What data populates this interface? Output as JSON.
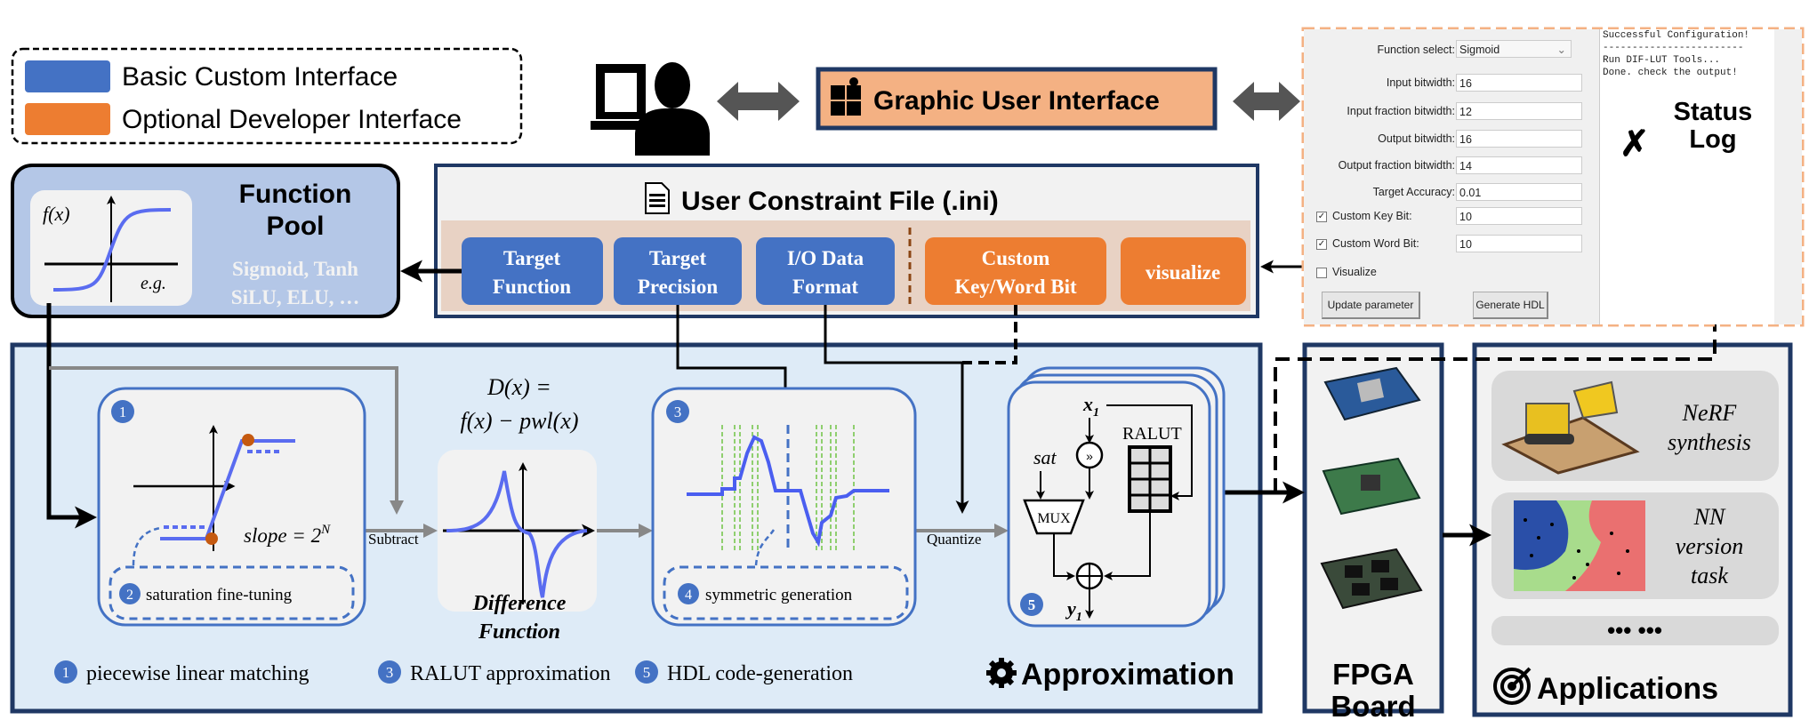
{
  "colors": {
    "basic": "#4472C4",
    "optional": "#ED7D31",
    "gui": "#F4B183",
    "frame": "#1F3864",
    "approx_bg": "#DEEBF7",
    "pool_bg": "#B4C7E7"
  },
  "legend": {
    "items": [
      {
        "label": "Basic Custom Interface",
        "color": "#4472C4"
      },
      {
        "label": "Optional Developer Interface",
        "color": "#ED7D31"
      }
    ]
  },
  "gui": {
    "title": "Graphic User Interface",
    "icon": "puzzle-icon"
  },
  "panel": {
    "function_select": {
      "label": "Function select:",
      "value": "Sigmoid"
    },
    "fields": [
      {
        "label": "Input bitwidth:",
        "value": "16"
      },
      {
        "label": "Input fraction bitwidth:",
        "value": "12"
      },
      {
        "label": "Output bitwidth:",
        "value": "16"
      },
      {
        "label": "Output fraction bitwidth:",
        "value": "14"
      },
      {
        "label": "Target Accuracy:",
        "value": "0.01"
      }
    ],
    "checks": [
      {
        "label": "Custom Key Bit:",
        "checked": true,
        "value": "10"
      },
      {
        "label": "Custom Word Bit:",
        "checked": true,
        "value": "10"
      },
      {
        "label": "Visualize",
        "checked": false
      }
    ],
    "buttons": {
      "update": "Update parameter",
      "generate": "Generate HDL"
    },
    "log": [
      "Successful Configuration!",
      "------------------------",
      "Run DIF-LUT Tools...",
      "Done. check the output!"
    ],
    "status_log": [
      "Status",
      "Log"
    ]
  },
  "function_pool": {
    "title": [
      "Function",
      "Pool"
    ],
    "fx": "f(x)",
    "eg": "e.g.",
    "examples": [
      "Sigmoid, Tanh",
      "SiLU, ELU, …"
    ]
  },
  "ucf": {
    "title": "User Constraint File (.ini)",
    "buttons": [
      {
        "lines": [
          "Target",
          "Function"
        ],
        "kind": "basic"
      },
      {
        "lines": [
          "Target",
          "Precision"
        ],
        "kind": "basic"
      },
      {
        "lines": [
          "I/O Data",
          "Format"
        ],
        "kind": "basic"
      },
      {
        "lines": [
          "Custom",
          "Key/Word Bit"
        ],
        "kind": "optional"
      },
      {
        "lines": [
          "visualize"
        ],
        "kind": "optional"
      }
    ]
  },
  "approx": {
    "title": "Approximation",
    "box1": {
      "badge": "1",
      "slope": "slope = 2",
      "slope_exp": "N",
      "sub_badge": "2",
      "sub_label": "saturation fine-tuning"
    },
    "subtract": "Subtract",
    "difference": {
      "eq1": "D(x) =",
      "eq2": "f(x) − pwl(x)",
      "label": [
        "Difference",
        "Function"
      ]
    },
    "box3": {
      "badge": "3",
      "sub_badge": "4",
      "sub_label": "symmetric generation"
    },
    "quantize": "Quantize",
    "box5": {
      "badge": "5",
      "x1": "x",
      "x1_sub": "1",
      "sat": "sat",
      "ralut": "RALUT",
      "mux": "MUX",
      "y1": "y",
      "y1_sub": "1"
    },
    "legend": [
      {
        "badge": "1",
        "label": "piecewise linear matching"
      },
      {
        "badge": "3",
        "label": "RALUT approximation"
      },
      {
        "badge": "5",
        "label": "HDL code-generation"
      }
    ]
  },
  "fpga": {
    "title": [
      "FPGA",
      "Board"
    ]
  },
  "applications": {
    "title": "Applications",
    "items": [
      {
        "lines": [
          "NeRF",
          "synthesis"
        ]
      },
      {
        "lines": [
          "NN",
          "version",
          "task"
        ]
      }
    ],
    "more": "••• •••"
  }
}
